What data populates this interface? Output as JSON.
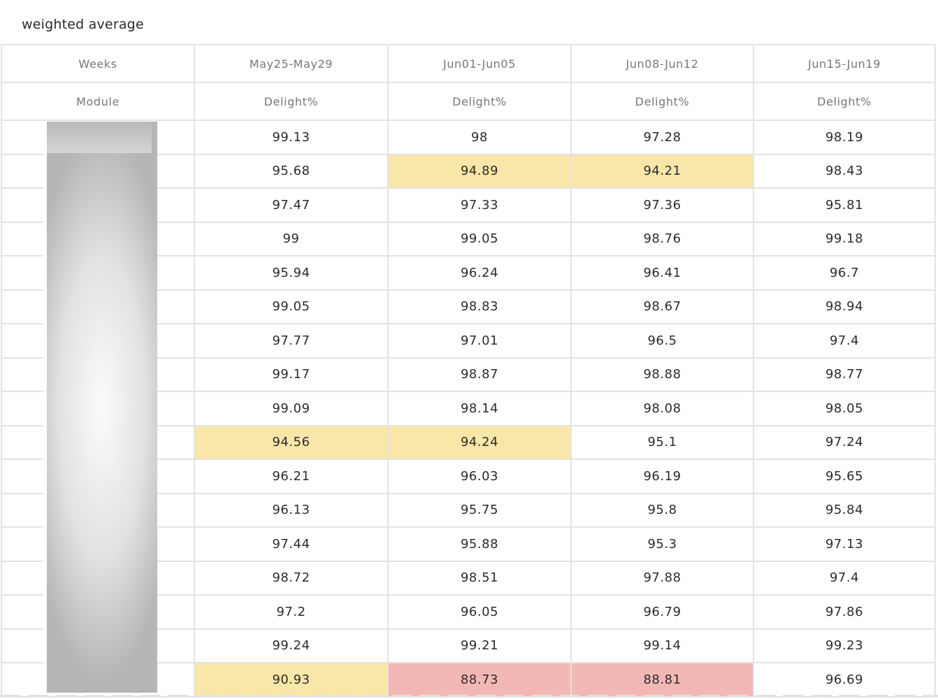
{
  "title": "weighted average",
  "header": {
    "weeks_label": "Weeks",
    "module_label": "Module",
    "weeks": [
      "May25-May29",
      "Jun01-Jun05",
      "Jun08-Jun12",
      "Jun15-Jun19"
    ],
    "metric_label": "Delight%"
  },
  "colors": {
    "highlight_yellow": "#f9e6a9",
    "highlight_red": "#f3b8b5",
    "grid_border": "#e3e3e3"
  },
  "rows": [
    {
      "values": [
        "99.13",
        "98",
        "97.28",
        "98.19"
      ],
      "highlight": [
        "",
        "",
        "",
        ""
      ]
    },
    {
      "values": [
        "95.68",
        "94.89",
        "94.21",
        "98.43"
      ],
      "highlight": [
        "",
        "yellow",
        "yellow",
        ""
      ]
    },
    {
      "values": [
        "97.47",
        "97.33",
        "97.36",
        "95.81"
      ],
      "highlight": [
        "",
        "",
        "",
        ""
      ]
    },
    {
      "values": [
        "99",
        "99.05",
        "98.76",
        "99.18"
      ],
      "highlight": [
        "",
        "",
        "",
        ""
      ]
    },
    {
      "values": [
        "95.94",
        "96.24",
        "96.41",
        "96.7"
      ],
      "highlight": [
        "",
        "",
        "",
        ""
      ]
    },
    {
      "values": [
        "99.05",
        "98.83",
        "98.67",
        "98.94"
      ],
      "highlight": [
        "",
        "",
        "",
        ""
      ]
    },
    {
      "values": [
        "97.77",
        "97.01",
        "96.5",
        "97.4"
      ],
      "highlight": [
        "",
        "",
        "",
        ""
      ]
    },
    {
      "values": [
        "99.17",
        "98.87",
        "98.88",
        "98.77"
      ],
      "highlight": [
        "",
        "",
        "",
        ""
      ]
    },
    {
      "values": [
        "99.09",
        "98.14",
        "98.08",
        "98.05"
      ],
      "highlight": [
        "",
        "",
        "",
        ""
      ]
    },
    {
      "values": [
        "94.56",
        "94.24",
        "95.1",
        "97.24"
      ],
      "highlight": [
        "yellow",
        "yellow",
        "",
        ""
      ]
    },
    {
      "values": [
        "96.21",
        "96.03",
        "96.19",
        "95.65"
      ],
      "highlight": [
        "",
        "",
        "",
        ""
      ]
    },
    {
      "values": [
        "96.13",
        "95.75",
        "95.8",
        "95.84"
      ],
      "highlight": [
        "",
        "",
        "",
        ""
      ]
    },
    {
      "values": [
        "97.44",
        "95.88",
        "95.3",
        "97.13"
      ],
      "highlight": [
        "",
        "",
        "",
        ""
      ]
    },
    {
      "values": [
        "98.72",
        "98.51",
        "97.88",
        "97.4"
      ],
      "highlight": [
        "",
        "",
        "",
        ""
      ]
    },
    {
      "values": [
        "97.2",
        "96.05",
        "96.79",
        "97.86"
      ],
      "highlight": [
        "",
        "",
        "",
        ""
      ]
    },
    {
      "values": [
        "99.24",
        "99.21",
        "99.14",
        "99.23"
      ],
      "highlight": [
        "",
        "",
        "",
        ""
      ]
    },
    {
      "values": [
        "90.93",
        "88.73",
        "88.81",
        "96.69"
      ],
      "highlight": [
        "yellow",
        "red",
        "red",
        ""
      ]
    }
  ]
}
